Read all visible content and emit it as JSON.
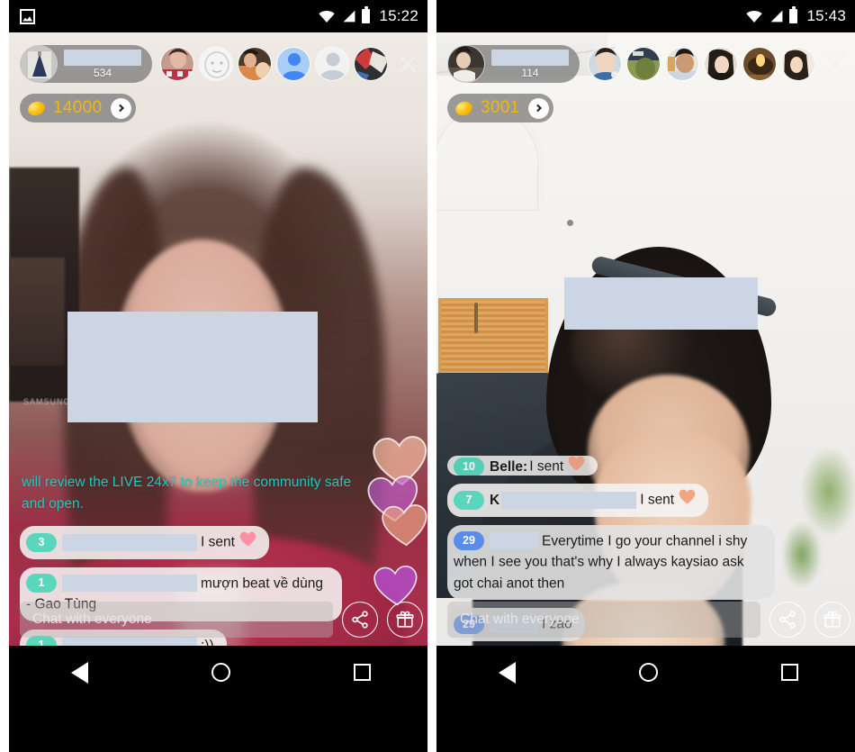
{
  "panels": [
    {
      "id": "left",
      "statusbar": {
        "time": "15:22",
        "icons": [
          "screenshot-icon",
          "wifi-icon",
          "signal-icon",
          "battery-icon"
        ]
      },
      "header": {
        "viewer_count": "534",
        "host_name_redacted": true,
        "close_label": "×",
        "coin": {
          "amount": "14000",
          "arrow": "›",
          "color": "#f2b70e"
        },
        "viewer_avatars": 6
      },
      "safety_notice": "will review the LIVE 24x7 to keep the community safe and open.",
      "messages": [
        {
          "badge": "3",
          "badge_color": "#5ad6bc",
          "name": "",
          "name_redacted": true,
          "redact_width": 150,
          "text": "I sent",
          "heart": "#ff8fa3",
          "bubble": "light"
        },
        {
          "badge": "1",
          "badge_color": "#5ad6bc",
          "name": "",
          "name_redacted": true,
          "redact_width": 150,
          "text": "mượn beat về dùng - Gao Tùng",
          "heart": "",
          "bubble": "light"
        },
        {
          "badge": "1",
          "badge_color": "#5ad6bc",
          "name": "",
          "name_redacted": true,
          "redact_width": 150,
          "text": ":))",
          "heart": "",
          "bubble": "light"
        }
      ],
      "chatbar": {
        "placeholder": "Chat with everyone",
        "value": "",
        "share_label": "share-icon",
        "gift_label": "gift-icon"
      },
      "navbar": {
        "back": "back-icon",
        "home": "home-icon",
        "recents": "recents-icon"
      }
    },
    {
      "id": "right",
      "statusbar": {
        "time": "15:43",
        "icons": [
          "wifi-icon",
          "signal-icon",
          "battery-icon"
        ]
      },
      "header": {
        "viewer_count": "114",
        "host_name_redacted": true,
        "close_label": "×",
        "coin": {
          "amount": "3001",
          "arrow": "›",
          "color": "#f2b70e"
        },
        "viewer_avatars": 6
      },
      "safety_notice": "",
      "messages": [
        {
          "badge": "10",
          "badge_color": "#5ad6bc",
          "name": "Belle:",
          "name_redacted": false,
          "redact_width": 0,
          "text": "I sent",
          "heart": "#f2a585",
          "bubble": "light",
          "clipped": true
        },
        {
          "badge": "7",
          "badge_color": "#5ad6bc",
          "name": "K",
          "name_redacted": true,
          "redact_width": 150,
          "text": "I sent",
          "heart": "#f2a585",
          "bubble": "light"
        },
        {
          "badge": "29",
          "badge_color": "#5b8ce8",
          "name": "",
          "name_redacted": true,
          "redact_width": 54,
          "text": "Everytime I go your channel i shy when I see you that's why I always kaysiao ask got chai anot then",
          "heart": "",
          "bubble": "gray"
        },
        {
          "badge": "29",
          "badge_color": "#5b8ce8",
          "name": "",
          "name_redacted": true,
          "redact_width": 54,
          "text": "I zao",
          "heart": "",
          "bubble": "gray"
        }
      ],
      "chatbar": {
        "placeholder": "Chat with everyone",
        "value": "",
        "share_label": "share-icon",
        "gift_label": "gift-icon"
      },
      "navbar": {
        "back": "back-icon",
        "home": "home-icon",
        "recents": "recents-icon"
      }
    }
  ]
}
